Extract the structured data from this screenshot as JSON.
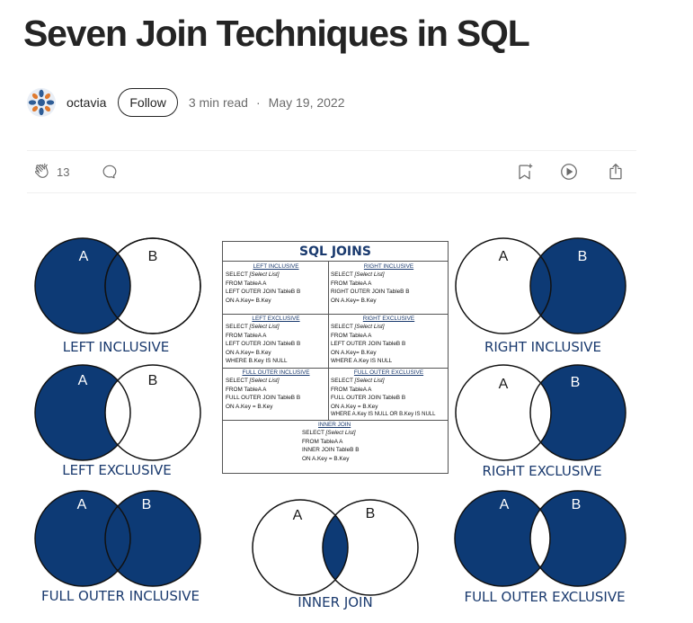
{
  "article": {
    "title": "Seven Join Techniques in SQL",
    "author": "octavia",
    "follow_label": "Follow",
    "read_time": "3 min read",
    "separator": "·",
    "date": "May 19, 2022"
  },
  "actions": {
    "clap_count": "13",
    "icons": [
      "clap-icon",
      "comment-icon",
      "bookmark-add-icon",
      "play-icon",
      "share-icon"
    ]
  },
  "infographic": {
    "colors": {
      "fill": "#0d3a75",
      "label": "#1a3a6e"
    },
    "circle_a": "A",
    "circle_b": "B",
    "labels": {
      "left_inclusive": "LEFT INCLUSIVE",
      "right_inclusive": "RIGHT INCLUSIVE",
      "left_exclusive": "LEFT EXCLUSIVE",
      "right_exclusive": "RIGHT EXCLUSIVE",
      "full_outer_inclusive": "FULL OUTER INCLUSIVE",
      "inner_join": "INNER JOIN",
      "full_outer_exclusive": "FULL OUTER EXCLUSIVE"
    },
    "sql_table": {
      "title": "SQL JOINS",
      "cells": {
        "left_inclusive": {
          "heading": "LEFT INCLUSIVE",
          "l1": "SELECT ",
          "l1i": "[Select List]",
          "l2": "FROM TableA A",
          "l3": "LEFT OUTER JOIN TableB B",
          "l4": "ON A.Key= B.Key"
        },
        "right_inclusive": {
          "heading": "RIGHT INCLUSIVE",
          "l1": "SELECT ",
          "l1i": "[Select List]",
          "l2": "FROM TableA A",
          "l3": "RIGHT OUTER JOIN TableB B",
          "l4": "ON A.Key= B.Key"
        },
        "left_exclusive": {
          "heading": "LEFT EXCLUSIVE",
          "l1": "SELECT ",
          "l1i": "[Select List]",
          "l2": "FROM TableA A",
          "l3": "LEFT OUTER JOIN TableB B",
          "l4": "ON A.Key= B.Key",
          "l5": "WHERE B.Key IS NULL"
        },
        "right_exclusive": {
          "heading": "RIGHT EXCLUSIVE",
          "l1": "SELECT ",
          "l1i": "[Select List]",
          "l2": "FROM TableA A",
          "l3": "LEFT OUTER JOIN TableB B",
          "l4": "ON A.Key= B.Key",
          "l5": "WHERE A.Key IS NULL"
        },
        "full_outer_inclusive": {
          "heading": "FULL OUTER INCLUSIVE",
          "l1": "SELECT ",
          "l1i": "[Select List]",
          "l2": "FROM TableA A",
          "l3": "FULL OUTER JOIN TableB B",
          "l4": "ON A.Key = B.Key"
        },
        "full_outer_exclusive": {
          "heading": "FULL OUTER EXCLUSIVE",
          "l1": "SELECT ",
          "l1i": "[Select List]",
          "l2": "FROM TableA A",
          "l3": "FULL OUTER JOIN TableB B",
          "l4": "ON A.Key = B.Key",
          "l5": "WHERE A.Key IS NULL OR B.Key IS NULL"
        },
        "inner_join": {
          "heading": "INNER JOIN",
          "l1": "SELECT ",
          "l1i": "[Select List]",
          "l2": "FROM TableA A",
          "l3": "INNER JOIN TableB B",
          "l4": "ON A.Key = B.Key"
        }
      }
    }
  }
}
